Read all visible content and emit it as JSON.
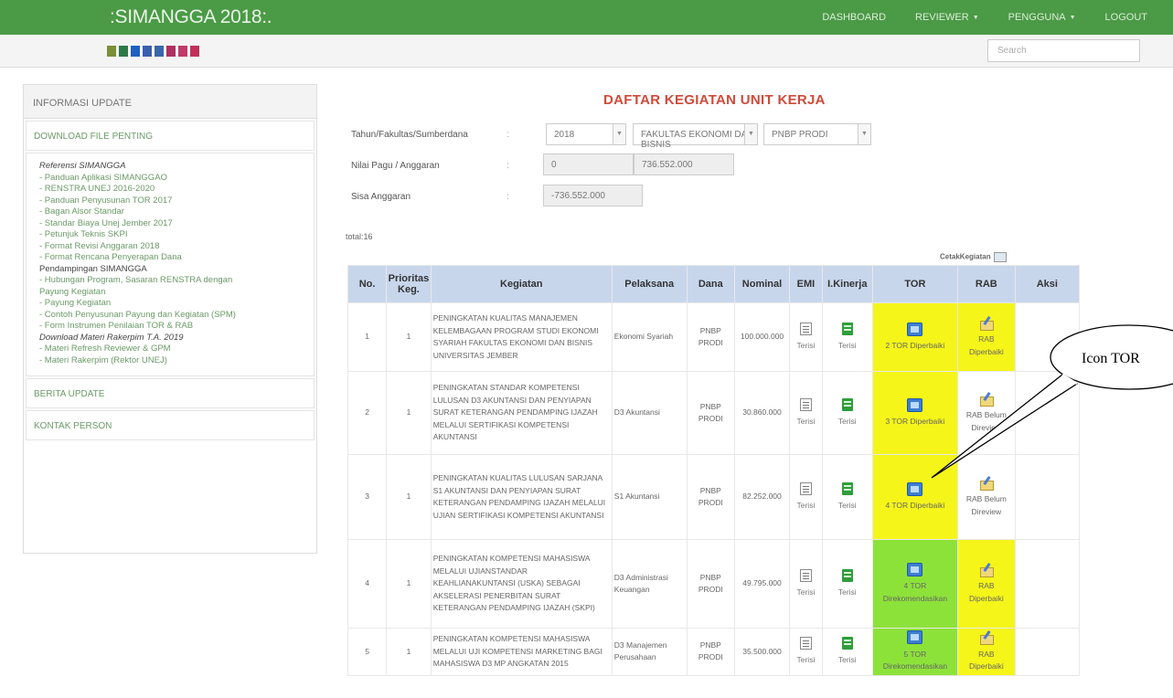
{
  "app": {
    "title": ":SIMANGGA 2018:."
  },
  "nav": {
    "items": [
      {
        "label": "DASHBOARD",
        "dropdown": false
      },
      {
        "label": "REVIEWER",
        "dropdown": true
      },
      {
        "label": "PENGGUNA",
        "dropdown": true
      },
      {
        "label": "LOGOUT",
        "dropdown": false
      }
    ]
  },
  "theme_swatches": [
    "#7a8f36",
    "#2c7a4a",
    "#1f5fbf",
    "#3a5fb0",
    "#3a66a8",
    "#b03060",
    "#c03a6a",
    "#c2305a"
  ],
  "search": {
    "placeholder": "Search"
  },
  "sidebar": {
    "header": "INFORMASI UPDATE",
    "download": "DOWNLOAD FILE PENTING",
    "lines": [
      {
        "text": "Referensi SIMANGGA",
        "kind": "sec"
      },
      {
        "text": "- Panduan Aplikasi SIMANGGAO",
        "kind": "lnk"
      },
      {
        "text": "- RENSTRA UNEJ 2016-2020",
        "kind": "lnk"
      },
      {
        "text": "- Panduan Penyusunan TOR 2017",
        "kind": "lnk"
      },
      {
        "text": "- Bagan Alsor Standar",
        "kind": "lnk"
      },
      {
        "text": "- Standar Biaya Unej Jember 2017",
        "kind": "lnk"
      },
      {
        "text": "- Petunjuk Teknis SKPI",
        "kind": "lnk"
      },
      {
        "text": "- Format Revisi Anggaran 2018",
        "kind": "lnk"
      },
      {
        "text": "- Format Rencana Penyerapan Dana",
        "kind": "lnk"
      },
      {
        "text": "Pendampingan SIMANGGA",
        "kind": "sec2"
      },
      {
        "text": "- Hubungan Program, Sasaran RENSTRA dengan",
        "kind": "lnk"
      },
      {
        "text": "Payung Kegiatan",
        "kind": "lnk"
      },
      {
        "text": "- Payung Kegiatan",
        "kind": "lnk"
      },
      {
        "text": "- Contoh Penyusunan Payung dan Kegiatan (SPM)",
        "kind": "lnk"
      },
      {
        "text": "- Form Instrumen Penilaian TOR & RAB",
        "kind": "lnk"
      },
      {
        "text": "Download Materi Rakerpim T.A. 2019",
        "kind": "sec"
      },
      {
        "text": "- Materi Refresh Reviewer & GPM",
        "kind": "lnk"
      },
      {
        "text": "- Materi Rakerpim (Rektor UNEJ)",
        "kind": "lnk"
      }
    ],
    "berita": "BERITA UPDATE",
    "kontak": "KONTAK PERSON"
  },
  "main": {
    "title": "DAFTAR KEGIATAN UNIT KERJA",
    "filter_label": "Tahun/Fakultas/Sumberdana",
    "year": "2018",
    "faculty": "FAKULTAS EKONOMI DAN BISNIS",
    "source": "PNBP PRODI",
    "pagu_label": "Nilai Pagu / Anggaran",
    "pagu_value": "0",
    "anggaran_value": "736.552.000",
    "sisa_label": "Sisa Anggaran",
    "sisa_value": "-736.552.000",
    "colon": ":",
    "total": "total:16",
    "cetak": "CetakKegiatan"
  },
  "table": {
    "headers": {
      "no": "No.",
      "prioritas": "Prioritas Keg.",
      "kegiatan": "Kegiatan",
      "pelaksana": "Pelaksana",
      "dana": "Dana",
      "nominal": "Nominal",
      "emi": "EMI",
      "kinerja": "I.Kinerja",
      "tor": "TOR",
      "rab": "RAB",
      "aksi": "Aksi"
    },
    "rows": [
      {
        "no": "1",
        "prioritas": "1",
        "kegiatan": "PENINGKATAN KUALITAS MANAJEMEN KELEMBAGAAN PROGRAM STUDI EKONOMI SYARIAH FAKULTAS EKONOMI DAN BISNIS UNIVERSITAS JEMBER",
        "pelaksana": "Ekonomi Syariah",
        "dana": "PNBP PRODI",
        "nominal": "100.000.000",
        "emi": "Terisi",
        "kinerja": "Terisi",
        "tor": "2 TOR Diperbaiki",
        "tor_color": "yellow",
        "rab": "RAB Diperbaiki",
        "rab_color": "yellow"
      },
      {
        "no": "2",
        "prioritas": "1",
        "kegiatan": "PENINGKATAN STANDAR KOMPETENSI LULUSAN D3 AKUNTANSI DAN PENYIAPAN SURAT KETERANGAN PENDAMPING IJAZAH MELALUI SERTIFIKASI KOMPETENSI AKUNTANSI",
        "pelaksana": "D3 Akuntansi",
        "dana": "PNBP PRODI",
        "nominal": "30.860.000",
        "emi": "Terisi",
        "kinerja": "Terisi",
        "tor": "3 TOR Diperbaiki",
        "tor_color": "yellow",
        "rab": "RAB Belum Direview",
        "rab_color": "white"
      },
      {
        "no": "3",
        "prioritas": "1",
        "kegiatan": "PENINGKATAN KUALITAS LULUSAN SARJANA S1 AKUNTANSI DAN PENYIAPAN SURAT KETERANGAN PENDAMPING IJAZAH MELALUI UJIAN SERTIFIKASI KOMPETENSI AKUNTANSI",
        "pelaksana": "S1 Akuntansi",
        "dana": "PNBP PRODI",
        "nominal": "82.252.000",
        "emi": "Terisi",
        "kinerja": "Terisi",
        "tor": "4 TOR Diperbaiki",
        "tor_color": "yellow",
        "rab": "RAB Belum Direview",
        "rab_color": "white"
      },
      {
        "no": "4",
        "prioritas": "1",
        "kegiatan": "PENINGKATAN KOMPETENSI MAHASISWA MELALUI UJIANSTANDAR KEAHLIANAKUNTANSI (USKA) SEBAGAI AKSELERASI PENERBITAN SURAT KETERANGAN PENDAMPING IJAZAH (SKPI)",
        "pelaksana": "D3 Administrasi Keuangan",
        "dana": "PNBP PRODI",
        "nominal": "49.795.000",
        "emi": "Terisi",
        "kinerja": "Terisi",
        "tor": "4 TOR Direkomendasikan",
        "tor_color": "green",
        "rab": "RAB Diperbaiki",
        "rab_color": "yellow"
      },
      {
        "no": "5",
        "prioritas": "1",
        "kegiatan": "PENINGKATAN KOMPETENSI MAHASISWA MELALUI UJI KOMPETENSI MARKETING BAGI MAHASISWA D3 MP ANGKATAN 2015",
        "pelaksana": "D3 Manajemen Perusahaan",
        "dana": "PNBP PRODI",
        "nominal": "35.500.000",
        "emi": "Terisi",
        "kinerja": "Terisi",
        "tor": "5 TOR Direkomendasikan",
        "tor_color": "green",
        "rab": "RAB Diperbaiki",
        "rab_color": "yellow"
      }
    ]
  },
  "callout": {
    "text": "Icon TOR"
  }
}
